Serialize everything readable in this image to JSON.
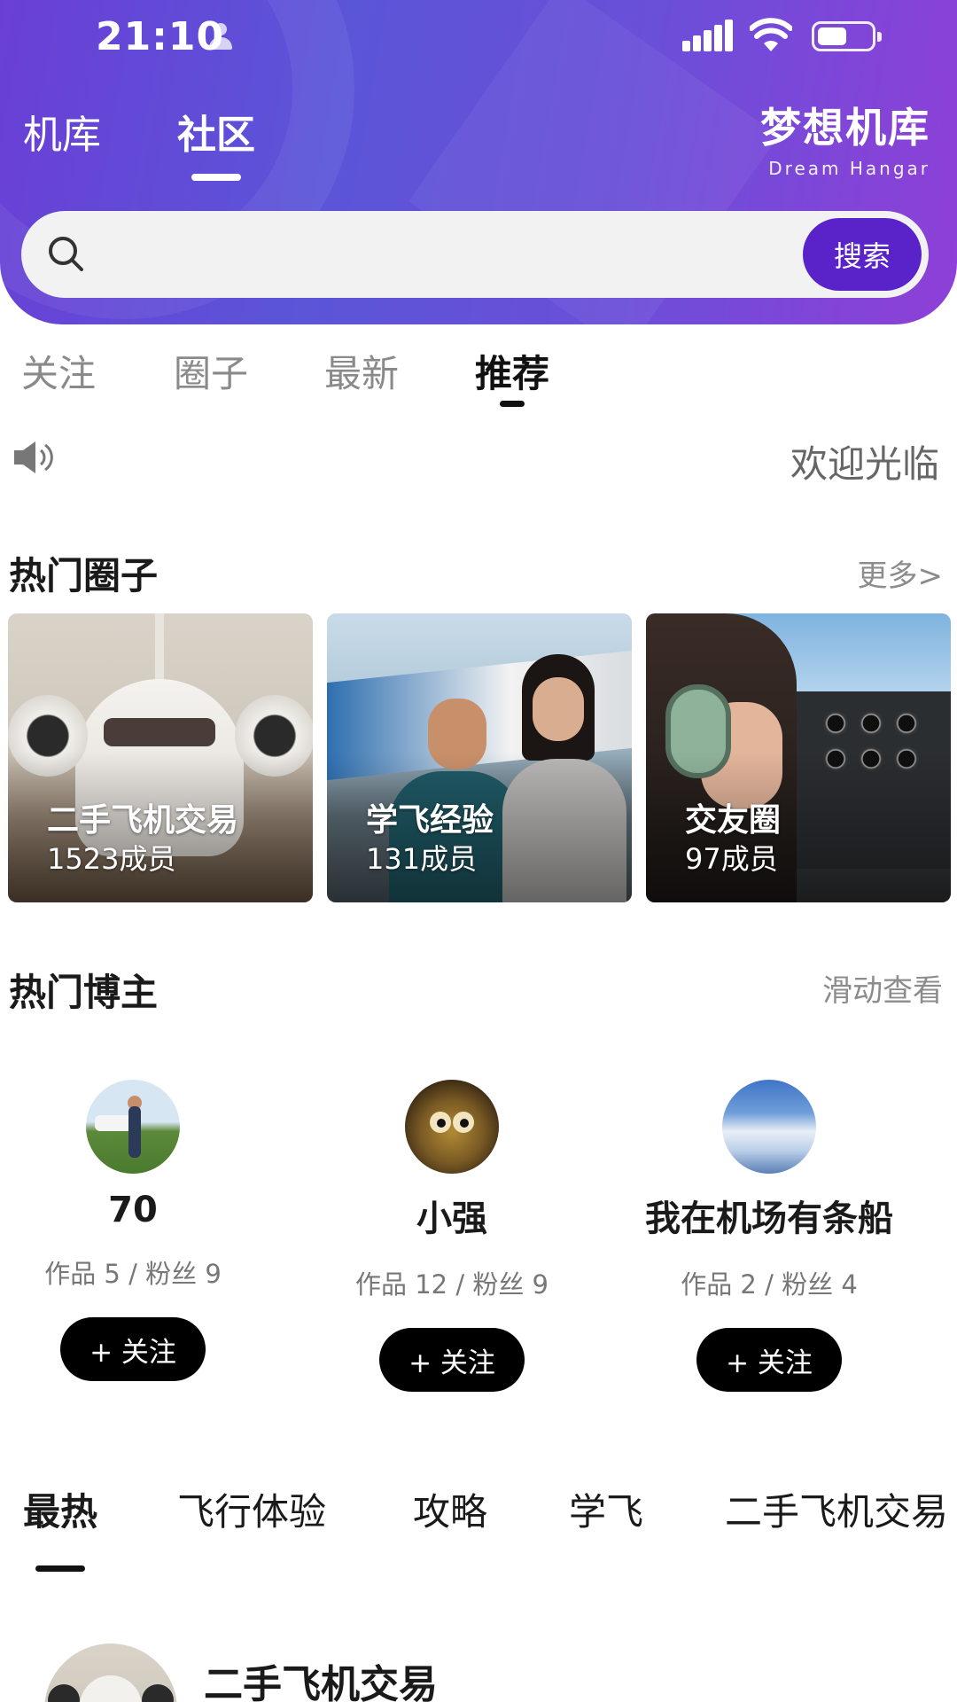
{
  "status_bar": {
    "time": "21:10"
  },
  "top_tabs": [
    {
      "label": "机库",
      "active": false
    },
    {
      "label": "社区",
      "active": true
    }
  ],
  "brand": {
    "name_cn": "梦想机库",
    "name_en": "Dream Hangar"
  },
  "search": {
    "placeholder": "",
    "button_label": "搜索"
  },
  "sub_tabs": [
    {
      "label": "关注",
      "active": false
    },
    {
      "label": "圈子",
      "active": false
    },
    {
      "label": "最新",
      "active": false
    },
    {
      "label": "推荐",
      "active": true
    }
  ],
  "notice": {
    "text": "欢迎光临",
    "icon": "speaker-icon"
  },
  "hot_circles": {
    "title": "热门圈子",
    "more_label": "更多>",
    "items": [
      {
        "name": "二手飞机交易",
        "members": "1523成员"
      },
      {
        "name": "学飞经验",
        "members": "131成员"
      },
      {
        "name": "交友圈",
        "members": "97成员"
      }
    ]
  },
  "hot_bloggers": {
    "title": "热门博主",
    "hint": "滑动查看",
    "items": [
      {
        "name": "70",
        "stats": "作品 5 / 粉丝 9",
        "follow_label": "+ 关注"
      },
      {
        "name": "小强",
        "stats": "作品 12 / 粉丝 9",
        "follow_label": "+ 关注"
      },
      {
        "name": "我在机场有条船",
        "stats": "作品 2 / 粉丝 4",
        "follow_label": "+ 关注"
      }
    ]
  },
  "category_tabs": [
    {
      "label": "最热",
      "active": true
    },
    {
      "label": "飞行体验",
      "active": false
    },
    {
      "label": "攻略",
      "active": false
    },
    {
      "label": "学飞",
      "active": false
    },
    {
      "label": "二手飞机交易",
      "active": false
    }
  ],
  "feed": [
    {
      "title": "二手飞机交易"
    }
  ],
  "colors": {
    "header_gradient_start": "#6a3fd6",
    "header_gradient_end": "#8f3fd8",
    "search_button": "#5a22c9",
    "follow_button": "#000000"
  }
}
